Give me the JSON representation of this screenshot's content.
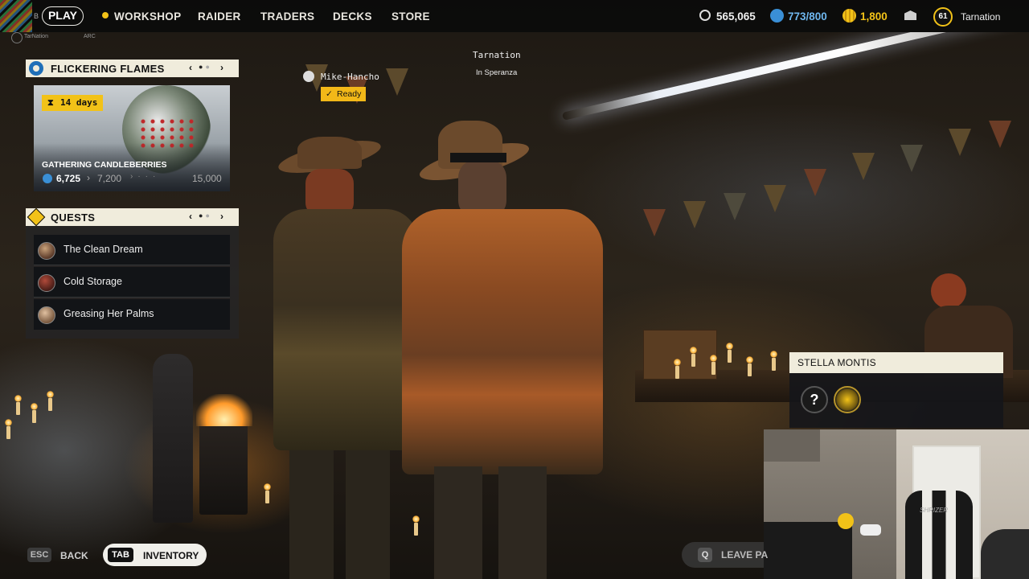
{
  "topbar": {
    "left_tag": "B",
    "player_tag_name": "TarNation",
    "player_tag_sub": "ARC",
    "play_label": "PLAY",
    "nav": [
      "WORKSHOP",
      "RAIDER",
      "TRADERS",
      "DECKS",
      "STORE"
    ],
    "coins": "565,065",
    "slots": "773/800",
    "tokens": "1,800",
    "level": "61",
    "username": "Tarnation"
  },
  "event": {
    "title": "FLICKERING FLAMES",
    "timer": "14 days",
    "task": "GATHERING CANDLEBERRIES",
    "progress_value": "6,725",
    "milestone": "7,200",
    "max": "15,000",
    "progress_fraction": 0.448
  },
  "quests": {
    "title": "QUESTS",
    "items": [
      {
        "label": "The Clean Dream"
      },
      {
        "label": "Cold Storage"
      },
      {
        "label": "Greasing Her Palms"
      }
    ]
  },
  "party": {
    "member_name": "Mike-Hancho",
    "member_status": "Ready",
    "self_name": "Tarnation",
    "location": "In Speranza"
  },
  "npc": {
    "name": "STELLA MONTIS",
    "unknown_icon": "?"
  },
  "bottom": {
    "back_key": "ESC",
    "back_label": "BACK",
    "inventory_key": "TAB",
    "inventory_label": "INVENTORY",
    "leave_key": "Q",
    "leave_label": "LEAVE PA"
  },
  "webcam": {
    "chair_text": "SHRIZER"
  },
  "colors": {
    "accent_yellow": "#f2c218",
    "panel_cream": "#f0ecdc",
    "ready_yellow": "#f2b818",
    "blue_icon": "#3a8fd6"
  }
}
